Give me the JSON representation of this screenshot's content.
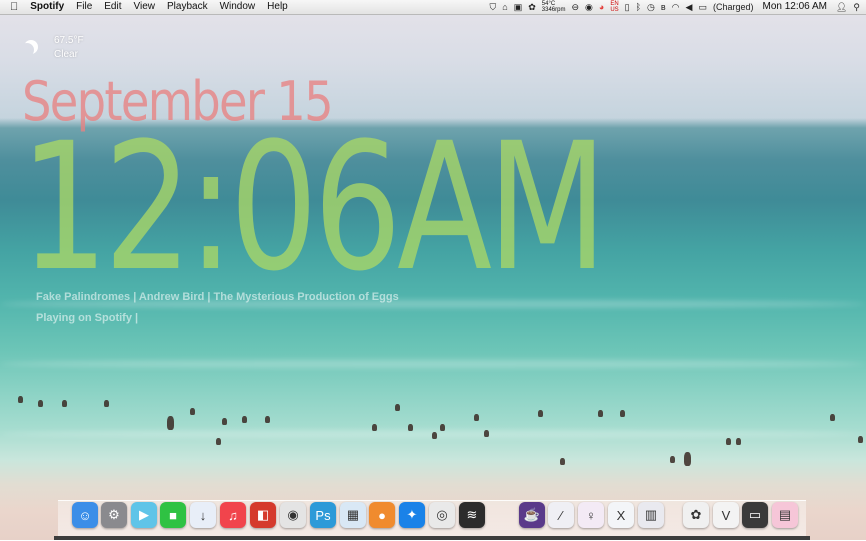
{
  "menubar": {
    "app_name": "Spotify",
    "menus": [
      "File",
      "Edit",
      "View",
      "Playback",
      "Window",
      "Help"
    ],
    "cpu_temp": "54°C",
    "fan_speed": "3346rpm",
    "battery_status": "(Charged)",
    "clock": "Mon 12:06 AM",
    "flag_top": "EN",
    "flag_bottom": "US"
  },
  "weather": {
    "temperature": "67.5°F",
    "condition": "Clear"
  },
  "clock_widget": {
    "date": "September 15",
    "time": "12:06AM"
  },
  "now_playing": {
    "line1": "Fake Palindromes  |  Andrew Bird  |  The Mysterious Production of Eggs",
    "line2": "Playing on Spotify  |"
  },
  "dock": {
    "apps": [
      {
        "name": "finder",
        "glyph": "☺",
        "bg": "#3b8ee8"
      },
      {
        "name": "system-preferences",
        "glyph": "⚙",
        "bg": "#8a8a8e"
      },
      {
        "name": "final-cut",
        "glyph": "▶",
        "bg": "#5fc4e8"
      },
      {
        "name": "facetime",
        "glyph": "■",
        "bg": "#2fc243"
      },
      {
        "name": "downloads",
        "glyph": "↓",
        "bg": "#e8eef8"
      },
      {
        "name": "music",
        "glyph": "♫",
        "bg": "#f1444c"
      },
      {
        "name": "photo-booth",
        "glyph": "◧",
        "bg": "#d53a2c"
      },
      {
        "name": "camera",
        "glyph": "◉",
        "bg": "#e4e4e4"
      },
      {
        "name": "photoshop",
        "glyph": "Ps",
        "bg": "#2d9ad8"
      },
      {
        "name": "preview",
        "glyph": "▦",
        "bg": "#d9e8f5"
      },
      {
        "name": "game-center",
        "glyph": "●",
        "bg": "#f08b2e"
      },
      {
        "name": "safari",
        "glyph": "✦",
        "bg": "#1a82e8"
      },
      {
        "name": "chrome",
        "glyph": "◎",
        "bg": "#e9e9e9"
      },
      {
        "name": "spotify",
        "glyph": "≋",
        "bg": "#2c2c2c"
      },
      {
        "name": "alfred",
        "glyph": "☕",
        "bg": "#5a3a8a"
      },
      {
        "name": "pen-tool",
        "glyph": "∕",
        "bg": "#efeff4"
      },
      {
        "name": "lightbulb",
        "glyph": "♀",
        "bg": "#f3eaf5"
      },
      {
        "name": "x-app",
        "glyph": "X",
        "bg": "#f3f5f8"
      },
      {
        "name": "color-strip",
        "glyph": "▥",
        "bg": "#e9e9ef"
      },
      {
        "name": "flower",
        "glyph": "✿",
        "bg": "#f0f0f0"
      },
      {
        "name": "vine",
        "glyph": "V",
        "bg": "#f3f3f3"
      },
      {
        "name": "terminal",
        "glyph": "▭",
        "bg": "#3a3a3a"
      },
      {
        "name": "notes",
        "glyph": "▤",
        "bg": "#f6c6d8"
      }
    ]
  },
  "colors": {
    "date_color": "#e88282",
    "time_color": "#a8d668"
  }
}
